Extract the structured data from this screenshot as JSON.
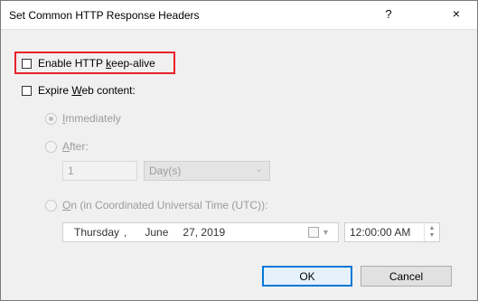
{
  "window": {
    "title": "Set Common HTTP Response Headers",
    "help_label": "?",
    "close_label": "×"
  },
  "options": {
    "keep_alive": {
      "prefix": "Enable HTTP ",
      "underline": "k",
      "suffix": "eep-alive",
      "checked": false
    },
    "expire": {
      "prefix": "Expire ",
      "underline": "W",
      "suffix": "eb content:",
      "checked": false
    }
  },
  "expire_mode": {
    "immediately": {
      "underline": "I",
      "suffix": "mmediately",
      "selected": true
    },
    "after": {
      "underline": "A",
      "suffix": "fter:",
      "selected": false
    },
    "on": {
      "underline": "O",
      "suffix": "n (in Coordinated Universal Time (UTC)):",
      "selected": false
    }
  },
  "after_value": "1",
  "after_unit": "Day(s)",
  "date": {
    "weekday": "Thursday",
    "sep": ",",
    "month": "June",
    "day_year": "27, 2019"
  },
  "time": "12:00:00 AM",
  "buttons": {
    "ok": "OK",
    "cancel": "Cancel"
  },
  "colors": {
    "highlight": "#e8222b",
    "default_button_border": "#0078d7"
  }
}
